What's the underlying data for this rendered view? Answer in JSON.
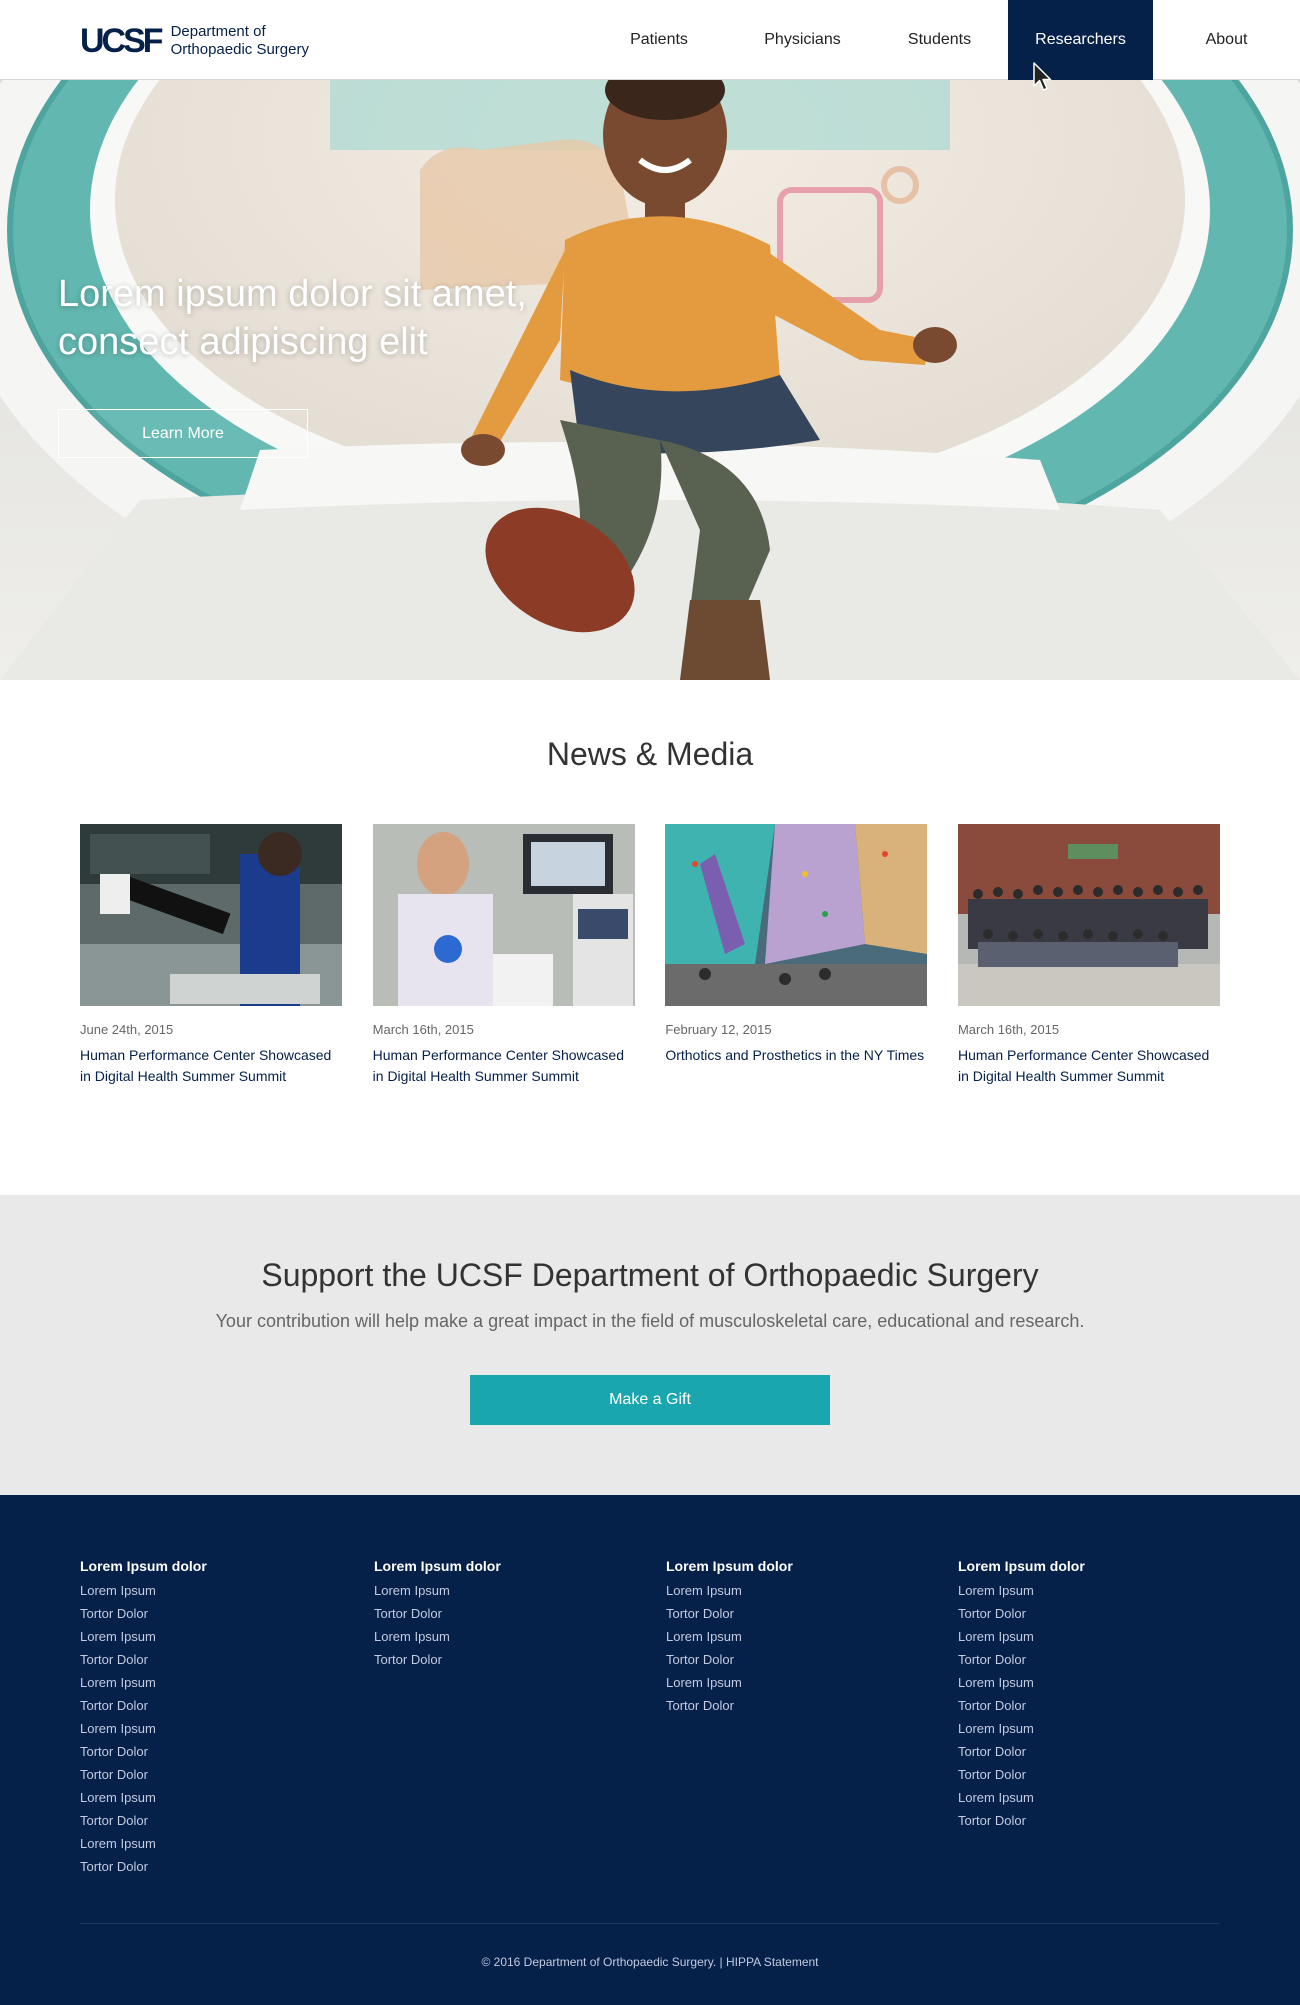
{
  "header": {
    "logo_mark": "UCSF",
    "logo_line1": "Department of",
    "logo_line2": "Orthopaedic Surgery",
    "nav": [
      {
        "label": "Patients"
      },
      {
        "label": "Physicians"
      },
      {
        "label": "Students"
      },
      {
        "label": "Researchers"
      },
      {
        "label": "About"
      }
    ],
    "active_nav": "Researchers"
  },
  "hero": {
    "title": "Lorem ipsum dolor sit amet, consect adipiscing elit",
    "button_label": "Learn More"
  },
  "news": {
    "title": "News & Media",
    "items": [
      {
        "date": "June 24th, 2015",
        "headline": "Human Performance Center Showcased in Digital Health Summer Summit"
      },
      {
        "date": "March 16th, 2015",
        "headline": "Human Performance Center Showcased in Digital Health Summer Summit"
      },
      {
        "date": "February 12, 2015",
        "headline": "Orthotics and Prosthetics in the NY Times"
      },
      {
        "date": "March 16th, 2015",
        "headline": "Human Performance Center Showcased in Digital Health Summer Summit"
      }
    ]
  },
  "support": {
    "title": "Support the UCSF Department of Orthopaedic Surgery",
    "text": "Your contribution will help make a great impact in the field of musculoskeletal care, educational and research.",
    "button_label": "Make a Gift"
  },
  "footer": {
    "columns": [
      {
        "heading": "Lorem Ipsum dolor",
        "links": [
          "Lorem Ipsum",
          "Tortor Dolor",
          "Lorem Ipsum",
          "Tortor Dolor",
          "Lorem Ipsum",
          "Tortor Dolor",
          "Lorem Ipsum",
          "Tortor Dolor",
          "Tortor Dolor",
          "Lorem Ipsum",
          "Tortor Dolor",
          "Lorem Ipsum",
          "Tortor Dolor"
        ]
      },
      {
        "heading": "Lorem Ipsum dolor",
        "links": [
          "Lorem Ipsum",
          "Tortor Dolor",
          "Lorem Ipsum",
          "Tortor Dolor"
        ]
      },
      {
        "heading": "Lorem Ipsum dolor",
        "links": [
          "Lorem Ipsum",
          "Tortor Dolor",
          "Lorem Ipsum",
          "Tortor Dolor",
          "Lorem Ipsum",
          "Tortor Dolor"
        ]
      },
      {
        "heading": "Lorem Ipsum dolor",
        "links": [
          "Lorem Ipsum",
          "Tortor Dolor",
          "Lorem Ipsum",
          "Tortor Dolor",
          "Lorem Ipsum",
          "Tortor Dolor",
          "Lorem Ipsum",
          "Tortor Dolor",
          "Tortor Dolor",
          "Lorem Ipsum",
          "Tortor Dolor"
        ]
      }
    ],
    "copyright": "© 2016  Department of Orthopaedic Surgery. |",
    "hippa_link": "HIPPA Statement"
  },
  "colors": {
    "brand_navy": "#052049",
    "accent_teal": "#19a6ae",
    "support_bg": "#e8e9e8"
  }
}
